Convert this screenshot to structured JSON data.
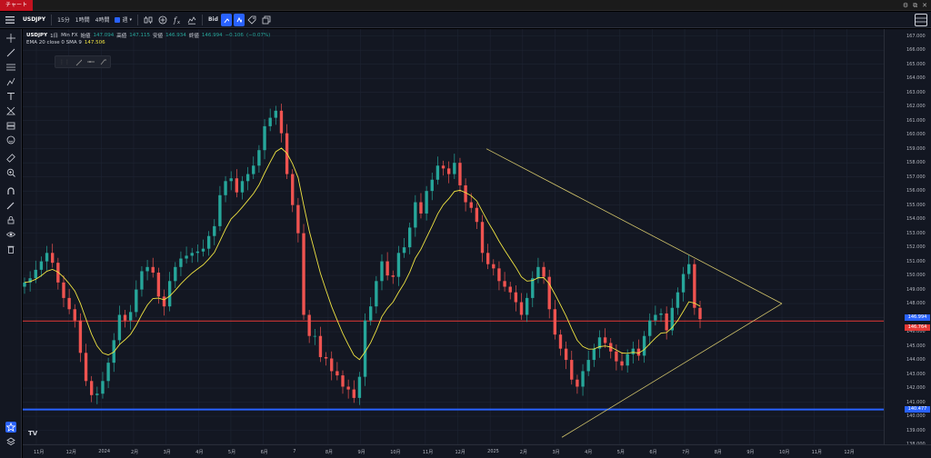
{
  "window": {
    "title": "チャート",
    "controls": [
      "⚙",
      "⧉",
      "✕"
    ]
  },
  "toolbar": {
    "symbol": "USDJPY",
    "intervals": [
      "15分",
      "1時間",
      "4時間"
    ],
    "interval_selected": "週",
    "bid_label": "Bid"
  },
  "legend": {
    "symbol": "USDJPY",
    "interval": "1日",
    "source": "Min FX",
    "open_label": "始値",
    "open": "147.094",
    "high_label": "高値",
    "high": "147.115",
    "low_label": "安値",
    "low": "146.934",
    "close_label": "終値",
    "close": "146.994",
    "change": "−0.106",
    "change_pct": "(−0.07%)",
    "ema_label": "EMA 20 close 0 SMA 9",
    "ema_value": "147.506"
  },
  "price_axis": {
    "ticks": [
      "167.000",
      "166.000",
      "165.000",
      "164.000",
      "163.000",
      "162.000",
      "161.000",
      "160.000",
      "159.000",
      "158.000",
      "157.000",
      "156.000",
      "155.000",
      "154.000",
      "153.000",
      "152.000",
      "151.000",
      "150.000",
      "149.000",
      "148.000",
      "147.000",
      "146.000",
      "145.000",
      "144.000",
      "143.000",
      "142.000",
      "141.000",
      "140.000",
      "139.000",
      "138.000"
    ],
    "last_price": "146.994",
    "red_line_price": "146.764",
    "blue_line_price": "140.477"
  },
  "time_axis": {
    "labels": [
      "11月",
      "12月",
      "2024",
      "2月",
      "3月",
      "4月",
      "5月",
      "6月",
      "7",
      "8月",
      "9月",
      "10月",
      "11月",
      "12月",
      "2025",
      "2月",
      "3月",
      "4月",
      "5月",
      "6月",
      "7月",
      "8月",
      "9月",
      "10月",
      "11月",
      "12月"
    ]
  },
  "colors": {
    "background": "#131722",
    "up_candle": "#26a69a",
    "down_candle": "#ef5350",
    "ema": "#f0e442",
    "red_level": "#e53935",
    "blue_level": "#2962ff",
    "trendline": "#d4c66b"
  },
  "chart_data": {
    "type": "candlestick",
    "symbol": "USDJPY",
    "interval": "1日",
    "ylim": [
      138,
      167.5
    ],
    "horizontal_levels": [
      146.764,
      140.477
    ],
    "closes": [
      149.5,
      149.8,
      150.4,
      151.0,
      151.6,
      150.9,
      149.5,
      148.4,
      147.6,
      146.8,
      144.5,
      142.5,
      141.5,
      141.6,
      142.5,
      143.8,
      145.4,
      147.2,
      146.8,
      147.4,
      149.0,
      150.3,
      150.6,
      150.2,
      148.5,
      147.8,
      149.6,
      150.6,
      151.2,
      151.4,
      151.6,
      151.7,
      151.9,
      152.8,
      153.5,
      155.7,
      156.7,
      156.9,
      155.9,
      156.7,
      157.2,
      157.8,
      158.9,
      160.6,
      161.2,
      161.7,
      160.1,
      157.2,
      155.0,
      153.0,
      147.2,
      145.7,
      145.7,
      144.2,
      144.1,
      143.2,
      142.9,
      142.1,
      141.9,
      141.3,
      142.8,
      146.8,
      147.8,
      149.6,
      151.0,
      150.0,
      149.9,
      151.6,
      152.0,
      153.4,
      155.2,
      154.4,
      156.0,
      156.8,
      157.8,
      157.6,
      157.2,
      158.0,
      156.4,
      155.2,
      154.8,
      153.8,
      151.6,
      150.8,
      150.5,
      149.6,
      149.2,
      148.8,
      148.1,
      147.2,
      148.4,
      149.8,
      150.6,
      149.9,
      147.6,
      145.8,
      144.8,
      144.0,
      142.6,
      142.1,
      143.2,
      144.0,
      144.8,
      145.6,
      145.2,
      144.6,
      143.9,
      143.6,
      144.4,
      144.8,
      144.3,
      145.7,
      146.8,
      147.2,
      147.3,
      146.1,
      147.7,
      148.8,
      150.1,
      150.8,
      147.7,
      146.9
    ]
  }
}
